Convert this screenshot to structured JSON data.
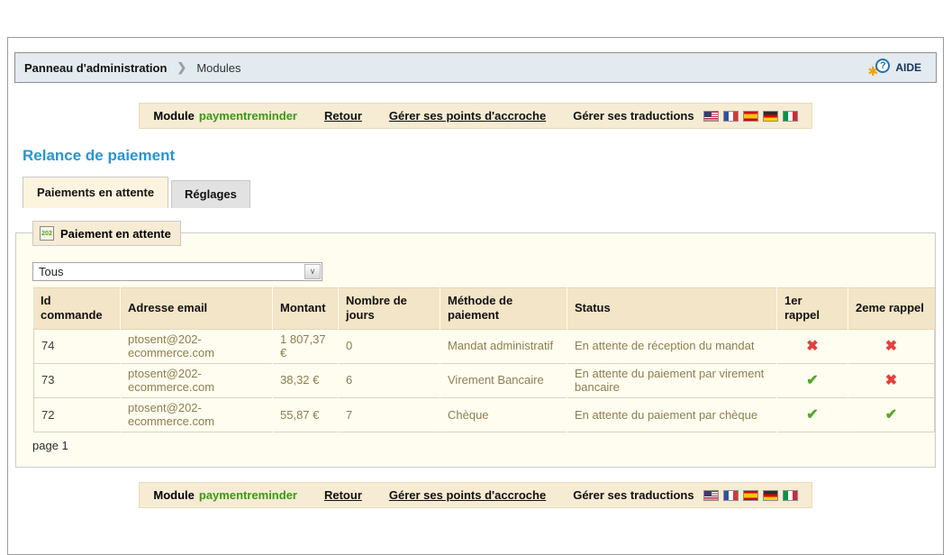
{
  "breadcrumb": {
    "section": "Panneau d'administration",
    "separator": "❯",
    "page": "Modules"
  },
  "help": {
    "label": "AIDE"
  },
  "module_bar": {
    "module_label": "Module",
    "module_name": "paymentreminder",
    "retour_label": "Retour",
    "hooks_label": "Gérer ses points d'accroche",
    "translations_label": "Gérer ses traductions",
    "flags": [
      "us",
      "fr",
      "es",
      "de",
      "it"
    ]
  },
  "page": {
    "title": "Relance de paiement"
  },
  "tabs": [
    {
      "label": "Paiements en attente",
      "active": true
    },
    {
      "label": "Réglages",
      "active": false
    }
  ],
  "panel": {
    "legend": "Paiement en attente",
    "legend_icon_text": "202",
    "filter": {
      "value": "Tous",
      "chevron": "∨"
    },
    "table": {
      "headers": [
        "Id commande",
        "Adresse email",
        "Montant",
        "Nombre de jours",
        "Méthode de paiement",
        "Status",
        "1er rappel",
        "2eme rappel"
      ],
      "rows": [
        {
          "id": "74",
          "email": "ptosent@202-ecommerce.com",
          "amount": "1 807,37 €",
          "days": "0",
          "method": "Mandat administratif",
          "status": "En attente de réception du mandat",
          "reminder1": "cross",
          "reminder2": "cross"
        },
        {
          "id": "73",
          "email": "ptosent@202-ecommerce.com",
          "amount": "38,32 €",
          "days": "6",
          "method": "Virement Bancaire",
          "status": "En attente du paiement par virement bancaire",
          "reminder1": "check",
          "reminder2": "cross"
        },
        {
          "id": "72",
          "email": "ptosent@202-ecommerce.com",
          "amount": "55,87 €",
          "days": "7",
          "method": "Chèque",
          "status": "En attente du paiement par chèque",
          "reminder1": "check",
          "reminder2": "check"
        }
      ],
      "marks": {
        "check": "✔",
        "cross": "✖"
      }
    },
    "pagination": "page 1"
  },
  "colors": {
    "title_blue": "#2795D2",
    "module_green": "#3A9A12",
    "check_green": "#54A728",
    "cross_red": "#E3403B",
    "header_tan": "#F3E5C7",
    "panel_cream": "#FEFDEF",
    "bar_cream": "#F6EBD3",
    "breadcrumb_bg": "#E3EAF0"
  }
}
